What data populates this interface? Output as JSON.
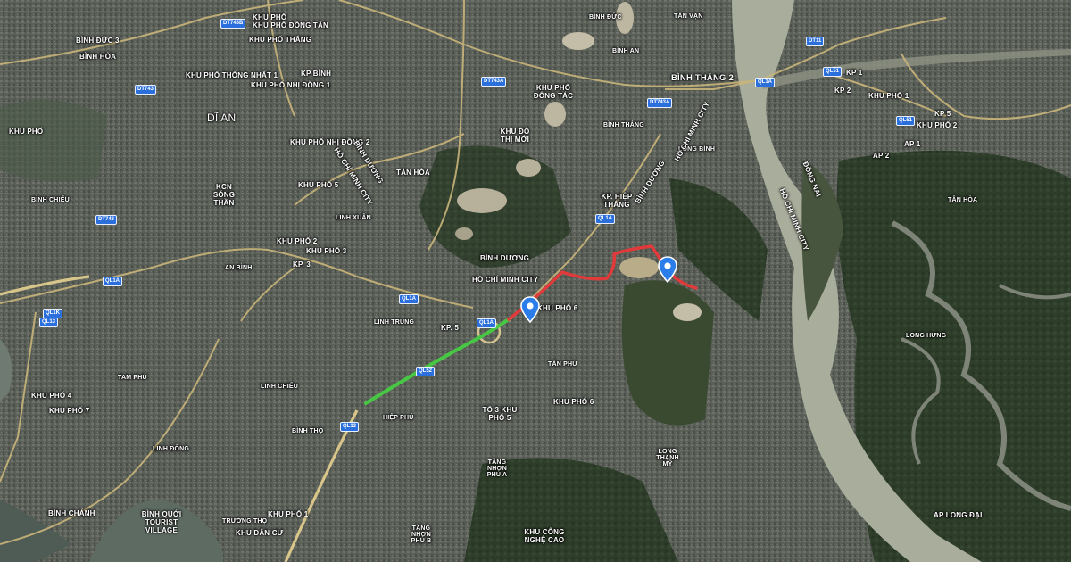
{
  "map": {
    "route_colors": {
      "traffic_slow": "#e03a3a",
      "traffic_clear": "#48c744"
    },
    "marker_color": "#2b7de9",
    "place_labels": [
      "KHU PHỐ ĐÔNG TÂN",
      "KHU PHỐ THẮNG",
      "KP BÌNH",
      "KHU PHỐ THỐNG NHẤT 1",
      "KHU PHỐ NHỊ ĐỒNG 1",
      "Dĩ An",
      "BÌNH ĐỨC 3",
      "BÌNH HÒA",
      "KHU PHỐ",
      "KHU PHỐ NHỊ ĐỒNG 2",
      "TÂN HÒA",
      "KHU PHỐ 5",
      "KCN SÓNG THẦN",
      "LINH XUÂN",
      "BÌNH CHIỂU",
      "KHU PHỐ 2",
      "KHU PHỐ 3",
      "KP. 3",
      "AN BÌNH",
      "BÌNH DƯƠNG",
      "HỒ CHÍ MINH CITY",
      "KHU PHỐ 6",
      "KP. 5",
      "LINH TRUNG",
      "TÂN PHÚ",
      "LINH CHIỂU",
      "HIỆP PHÚ",
      "TỔ 3 KHU PHỐ 5",
      "KHU PHỐ 4",
      "KHU PHỐ 7",
      "TAM PHÚ",
      "BÌNH THỌ",
      "LINH ĐÔNG",
      "KHU PHỐ 1",
      "KHU PHỐ 6",
      "BÌNH QUỚI TOURIST VILLAGE",
      "BÌNH CHÁNH",
      "TRƯỜNG THỌ",
      "KHU DÂN CƯ",
      "TĂNG NHƠN PHÚ A",
      "TĂNG NHƠN PHÚ B",
      "KHU CÔNG NGHỆ CAO",
      "LONG THẠNH MỸ",
      "KHU ĐÔ THỊ MỚI",
      "KHU PHỐ ĐÔNG TÁC",
      "BÌNH THẮNG",
      "KP. HIỆP THẮNG",
      "BÌNH THẮNG 2",
      "TÂN VẠN",
      "LONG BÌNH",
      "KP 1",
      "KP 2",
      "AP 1",
      "AP 2",
      "KHU PHỐ 1",
      "KHU PHỐ 2",
      "KP 5",
      "LONG HƯNG",
      "AP LONG ĐẠI",
      "ĐỒNG NAI",
      "HỒ CHÍ MINH CITY",
      "TÂN HÒA",
      "BÌNH AN",
      "BÌNH ĐỨC"
    ],
    "road_shields": [
      "DT743B",
      "DT743",
      "DT743A",
      "DT743",
      "QL1A",
      "QL1A",
      "QL1A",
      "QL13",
      "QL1K",
      "QL1A",
      "QL1A",
      "DT11",
      "QL51",
      "QL51",
      "DT743A",
      "QL52",
      "QL13"
    ]
  }
}
